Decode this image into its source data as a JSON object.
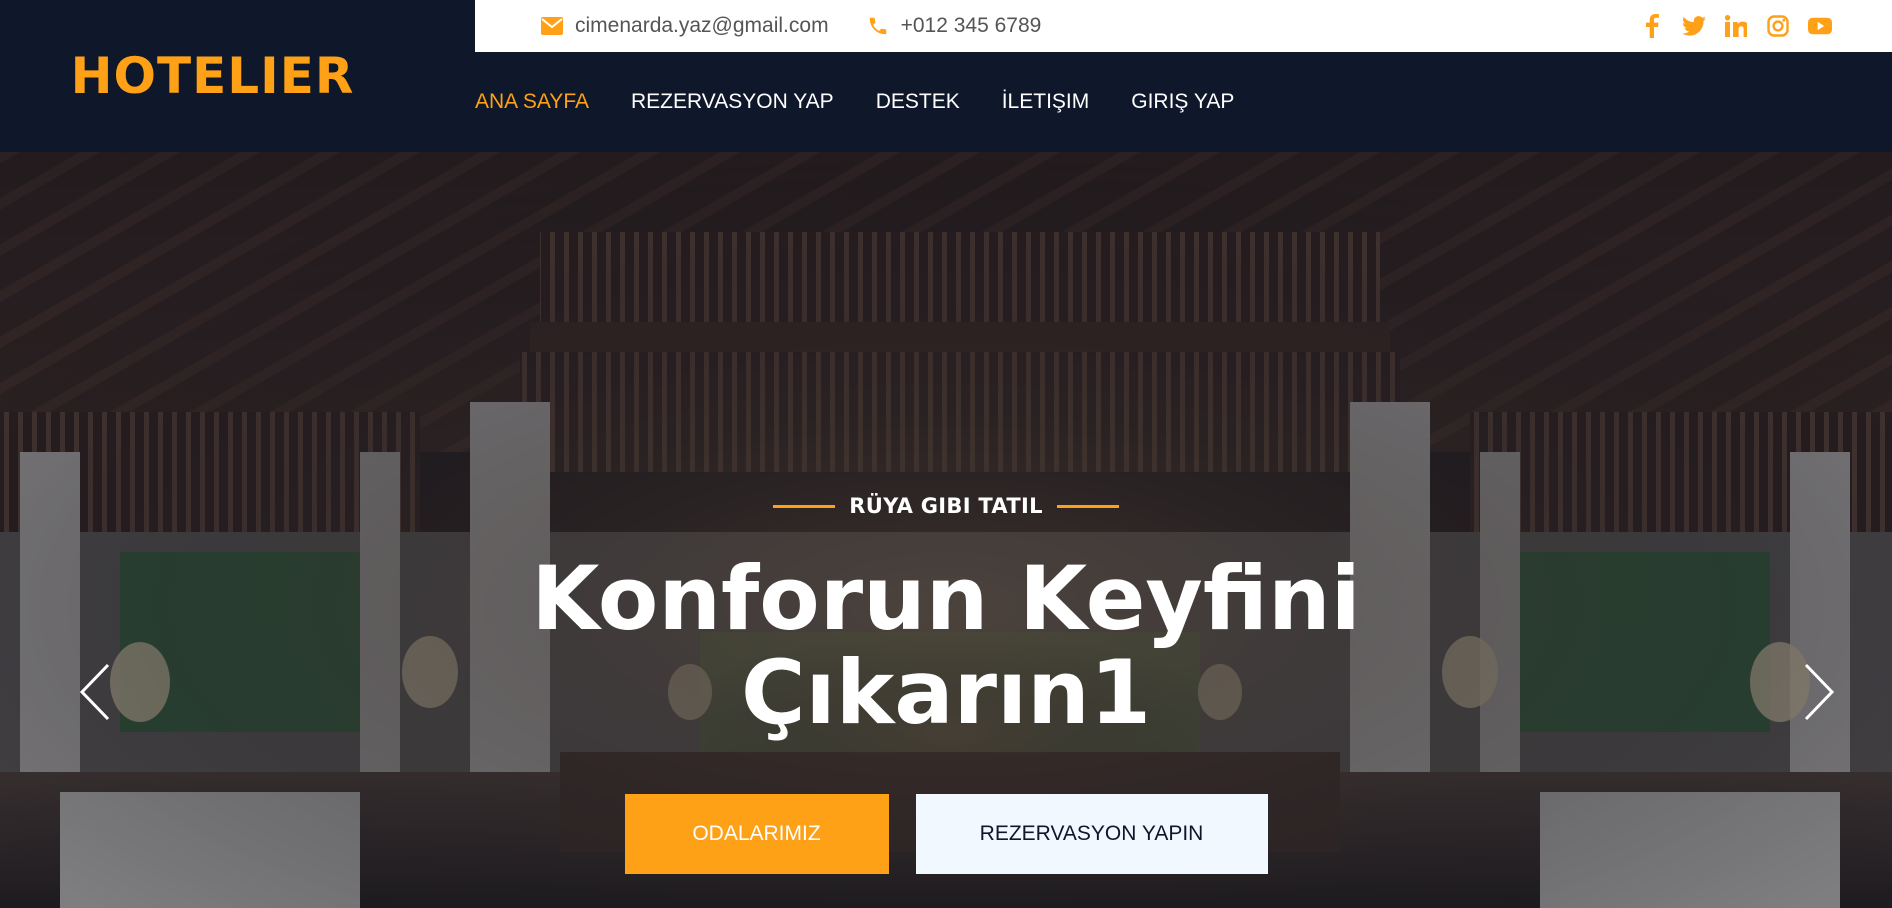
{
  "brand": {
    "name": "HOTELIER"
  },
  "topbar": {
    "email": "cimenarda.yaz@gmail.com",
    "phone": "+012 345 6789",
    "socials": [
      "facebook-icon",
      "twitter-icon",
      "linkedin-icon",
      "instagram-icon",
      "youtube-icon"
    ]
  },
  "nav": {
    "items": [
      {
        "label": "ANA SAYFA",
        "active": true
      },
      {
        "label": "REZERVASYON YAP",
        "active": false
      },
      {
        "label": "DESTEK",
        "active": false
      },
      {
        "label": "İLETIŞIM",
        "active": false
      },
      {
        "label": "GIRIŞ YAP",
        "active": false
      }
    ]
  },
  "hero": {
    "tagline": "RÜYA GIBI TATIL",
    "headline_line1": "Konforun Keyfini",
    "headline_line2": "Çıkarın1",
    "primary_button": "ODALARIMIZ",
    "secondary_button": "REZERVASYON YAPIN"
  },
  "colors": {
    "accent": "#fea116",
    "dark": "#0f172b",
    "light": "#f1f8ff"
  }
}
